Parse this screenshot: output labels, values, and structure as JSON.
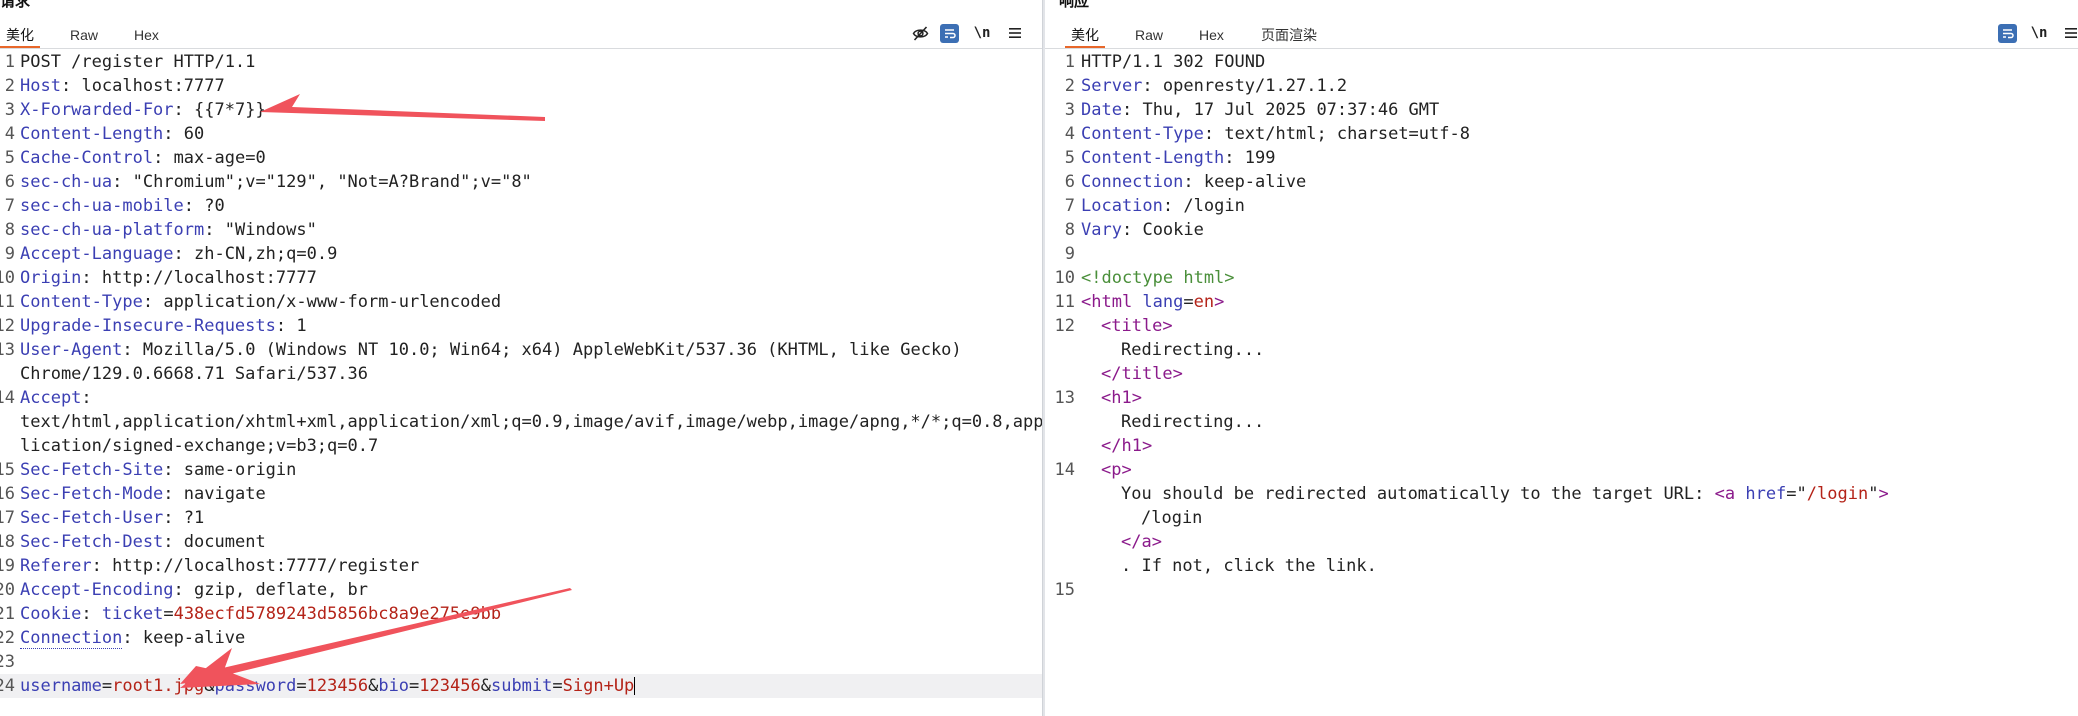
{
  "request": {
    "title": "请求",
    "tabs": [
      {
        "label": "美化",
        "active": true
      },
      {
        "label": "Raw",
        "active": false
      },
      {
        "label": "Hex",
        "active": false
      }
    ],
    "toolbar": {
      "hide_icon": "eye-slash-icon",
      "wrap_icon": "wrap-lines-icon",
      "newline_label": "\\n",
      "menu_icon": "menu-icon"
    },
    "lines": [
      {
        "n": "1",
        "plain": "POST /register HTTP/1.1"
      },
      {
        "n": "2",
        "name": "Host",
        "value": "localhost:7777"
      },
      {
        "n": "3",
        "name": "X-Forwarded-For",
        "value": "{{7*7}}"
      },
      {
        "n": "4",
        "name": "Content-Length",
        "value": "60"
      },
      {
        "n": "5",
        "name": "Cache-Control",
        "value": "max-age=0"
      },
      {
        "n": "6",
        "name": "sec-ch-ua",
        "value": "\"Chromium\";v=\"129\", \"Not=A?Brand\";v=\"8\""
      },
      {
        "n": "7",
        "name": "sec-ch-ua-mobile",
        "value": "?0"
      },
      {
        "n": "8",
        "name": "sec-ch-ua-platform",
        "value": "\"Windows\""
      },
      {
        "n": "9",
        "name": "Accept-Language",
        "value": "zh-CN,zh;q=0.9"
      },
      {
        "n": "10",
        "name": "Origin",
        "value": "http://localhost:7777"
      },
      {
        "n": "11",
        "name": "Content-Type",
        "value": "application/x-www-form-urlencoded"
      },
      {
        "n": "12",
        "name": "Upgrade-Insecure-Requests",
        "value": "1"
      },
      {
        "n": "13",
        "name": "User-Agent",
        "value": "Mozilla/5.0 (Windows NT 10.0; Win64; x64) AppleWebKit/537.36 (KHTML, like Gecko)"
      },
      {
        "n": "",
        "plain": "Chrome/129.0.6668.71 Safari/537.36"
      },
      {
        "n": "14",
        "name": "Accept",
        "value": ""
      },
      {
        "n": "",
        "plain": "text/html,application/xhtml+xml,application/xml;q=0.9,image/avif,image/webp,image/apng,*/*;q=0.8,app"
      },
      {
        "n": "",
        "plain": "lication/signed-exchange;v=b3;q=0.7"
      },
      {
        "n": "15",
        "name": "Sec-Fetch-Site",
        "value": "same-origin"
      },
      {
        "n": "16",
        "name": "Sec-Fetch-Mode",
        "value": "navigate"
      },
      {
        "n": "17",
        "name": "Sec-Fetch-User",
        "value": "?1"
      },
      {
        "n": "18",
        "name": "Sec-Fetch-Dest",
        "value": "document"
      },
      {
        "n": "19",
        "name": "Referer",
        "value": "http://localhost:7777/register"
      },
      {
        "n": "20",
        "name": "Accept-Encoding",
        "value": "gzip, deflate, br"
      },
      {
        "n": "21",
        "name": "Cookie",
        "cookie_name": "ticket",
        "cookie_value": "438ecfd5789243d5856bc8a9e275e9bb"
      },
      {
        "n": "22",
        "name": "Connection",
        "value": "keep-alive",
        "dotted": true
      },
      {
        "n": "23",
        "plain": ""
      },
      {
        "n": "24",
        "body": [
          {
            "k": "username",
            "v": "root1.jpg"
          },
          {
            "k": "password",
            "v": "123456"
          },
          {
            "k": "bio",
            "v": "123456"
          },
          {
            "k": "submit",
            "v": "Sign+Up"
          }
        ]
      }
    ]
  },
  "response": {
    "title": "响应",
    "tabs": [
      {
        "label": "美化",
        "active": true
      },
      {
        "label": "Raw",
        "active": false
      },
      {
        "label": "Hex",
        "active": false
      },
      {
        "label": "页面渲染",
        "active": false
      }
    ],
    "toolbar": {
      "wrap_icon": "wrap-lines-icon",
      "newline_label": "\\n",
      "menu_icon": "menu-icon"
    },
    "lines": [
      {
        "n": "1",
        "plain": "HTTP/1.1 302 FOUND"
      },
      {
        "n": "2",
        "name": "Server",
        "value": "openresty/1.27.1.2"
      },
      {
        "n": "3",
        "name": "Date",
        "value": "Thu, 17 Jul 2025 07:37:46 GMT"
      },
      {
        "n": "4",
        "name": "Content-Type",
        "value": "text/html; charset=utf-8"
      },
      {
        "n": "5",
        "name": "Content-Length",
        "value": "199"
      },
      {
        "n": "6",
        "name": "Connection",
        "value": "keep-alive"
      },
      {
        "n": "7",
        "name": "Location",
        "value": "/login"
      },
      {
        "n": "8",
        "name": "Vary",
        "value": "Cookie"
      },
      {
        "n": "9",
        "plain": ""
      },
      {
        "n": "10",
        "html": [
          {
            "c": "ptag",
            "t": "<!doctype html>"
          }
        ]
      },
      {
        "n": "11",
        "html": [
          {
            "c": "tag",
            "t": "<html "
          },
          {
            "c": "attr",
            "t": "lang"
          },
          {
            "c": "",
            "t": "="
          },
          {
            "c": "aval",
            "t": "en"
          },
          {
            "c": "tag",
            "t": ">"
          }
        ]
      },
      {
        "n": "12",
        "indent": 1,
        "html": [
          {
            "c": "tag",
            "t": "<title>"
          }
        ]
      },
      {
        "n": "",
        "indent": 2,
        "html": [
          {
            "c": "",
            "t": "Redirecting..."
          }
        ]
      },
      {
        "n": "",
        "indent": 1,
        "html": [
          {
            "c": "tag",
            "t": "</title>"
          }
        ]
      },
      {
        "n": "13",
        "indent": 1,
        "html": [
          {
            "c": "tag",
            "t": "<h1>"
          }
        ]
      },
      {
        "n": "",
        "indent": 2,
        "html": [
          {
            "c": "",
            "t": "Redirecting..."
          }
        ]
      },
      {
        "n": "",
        "indent": 1,
        "html": [
          {
            "c": "tag",
            "t": "</h1>"
          }
        ]
      },
      {
        "n": "14",
        "indent": 1,
        "html": [
          {
            "c": "tag",
            "t": "<p>"
          }
        ]
      },
      {
        "n": "",
        "indent": 2,
        "html": [
          {
            "c": "",
            "t": "You should be redirected automatically to the target URL: "
          },
          {
            "c": "tag",
            "t": "<a "
          },
          {
            "c": "attr",
            "t": "href"
          },
          {
            "c": "",
            "t": "=\""
          },
          {
            "c": "aval",
            "t": "/login"
          },
          {
            "c": "",
            "t": "\""
          },
          {
            "c": "tag",
            "t": ">"
          }
        ]
      },
      {
        "n": "",
        "indent": 3,
        "html": [
          {
            "c": "",
            "t": "/login"
          }
        ]
      },
      {
        "n": "",
        "indent": 2,
        "html": [
          {
            "c": "tag",
            "t": "</a>"
          }
        ]
      },
      {
        "n": "",
        "indent": 2,
        "html": [
          {
            "c": "",
            "t": ". If not, click the link."
          }
        ]
      },
      {
        "n": "15",
        "plain": ""
      }
    ]
  },
  "annotations": {
    "arrow_color": "#f0535c"
  }
}
